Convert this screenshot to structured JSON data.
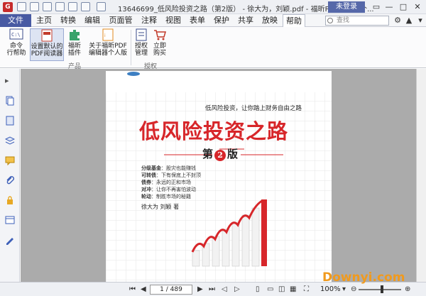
{
  "window": {
    "title": "13646699_低风险投资之路（第2版） - 徐大为，刘颖.pdf - 福昕PDF编辑器个...",
    "login_label": "未登录",
    "minimize": "—",
    "maximize": "□",
    "close": "✕"
  },
  "menus": [
    "文件",
    "主页",
    "转换",
    "编辑",
    "页面管",
    "注释",
    "视图",
    "表单",
    "保护",
    "共享",
    "放映",
    "帮助"
  ],
  "active_menu": "帮助",
  "search": {
    "placeholder": "查找"
  },
  "ribbon": {
    "buttons": [
      {
        "label1": "命令",
        "label2": "行帮助"
      },
      {
        "label1": "设置默认的",
        "label2": "PDF阅读器"
      },
      {
        "label1": "福昕",
        "label2": "插件"
      },
      {
        "label1": "关于福昕PDF",
        "label2": "编辑器个人版"
      },
      {
        "label1": "授权",
        "label2": "管理"
      },
      {
        "label1": "立即",
        "label2": "购买"
      }
    ],
    "groups": [
      "产品",
      "授权"
    ]
  },
  "book": {
    "tagline": "低风险投资，让你踏上财务自由之路",
    "title": "低风险投资之路",
    "edition_pre": "第",
    "edition_num": "2",
    "edition_post": "版",
    "points": [
      {
        "k": "分级基金",
        "v": "：股灾也能赚钱"
      },
      {
        "k": "可转债",
        "v": "：下有保底上不封顶"
      },
      {
        "k": "债券",
        "v": "：永远的正和市场"
      },
      {
        "k": "对冲",
        "v": "：让你不再害怕波动"
      },
      {
        "k": "轮动",
        "v": "：制胜市场的秘籍"
      }
    ],
    "authors": "徐大为  刘颖  著"
  },
  "status": {
    "page": "1 / 489",
    "zoom": "100%"
  },
  "watermark": "Downyi.com",
  "colors": {
    "accent": "#485aa3",
    "title_red": "#d7262a"
  }
}
